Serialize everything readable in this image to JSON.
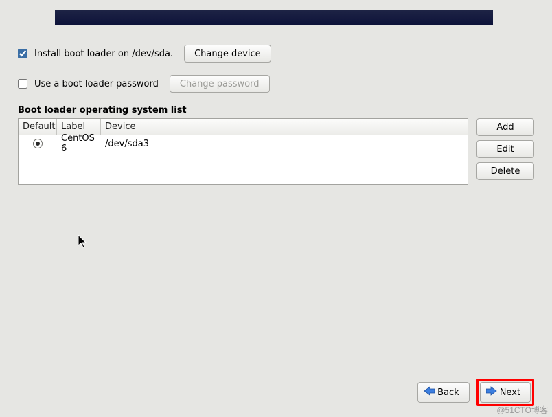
{
  "install_loader": {
    "checked": true,
    "label": "Install boot loader on /dev/sda.",
    "change_button": "Change device"
  },
  "use_password": {
    "checked": false,
    "label": "Use a boot loader password",
    "change_button": "Change password"
  },
  "os_list": {
    "title": "Boot loader operating system list",
    "headers": {
      "default": "Default",
      "label": "Label",
      "device": "Device"
    },
    "rows": [
      {
        "default": true,
        "label": "CentOS 6",
        "device": "/dev/sda3"
      }
    ]
  },
  "side_buttons": {
    "add": "Add",
    "edit": "Edit",
    "delete": "Delete"
  },
  "footer": {
    "back": "Back",
    "next": "Next"
  },
  "watermark": "@51CTO博客"
}
